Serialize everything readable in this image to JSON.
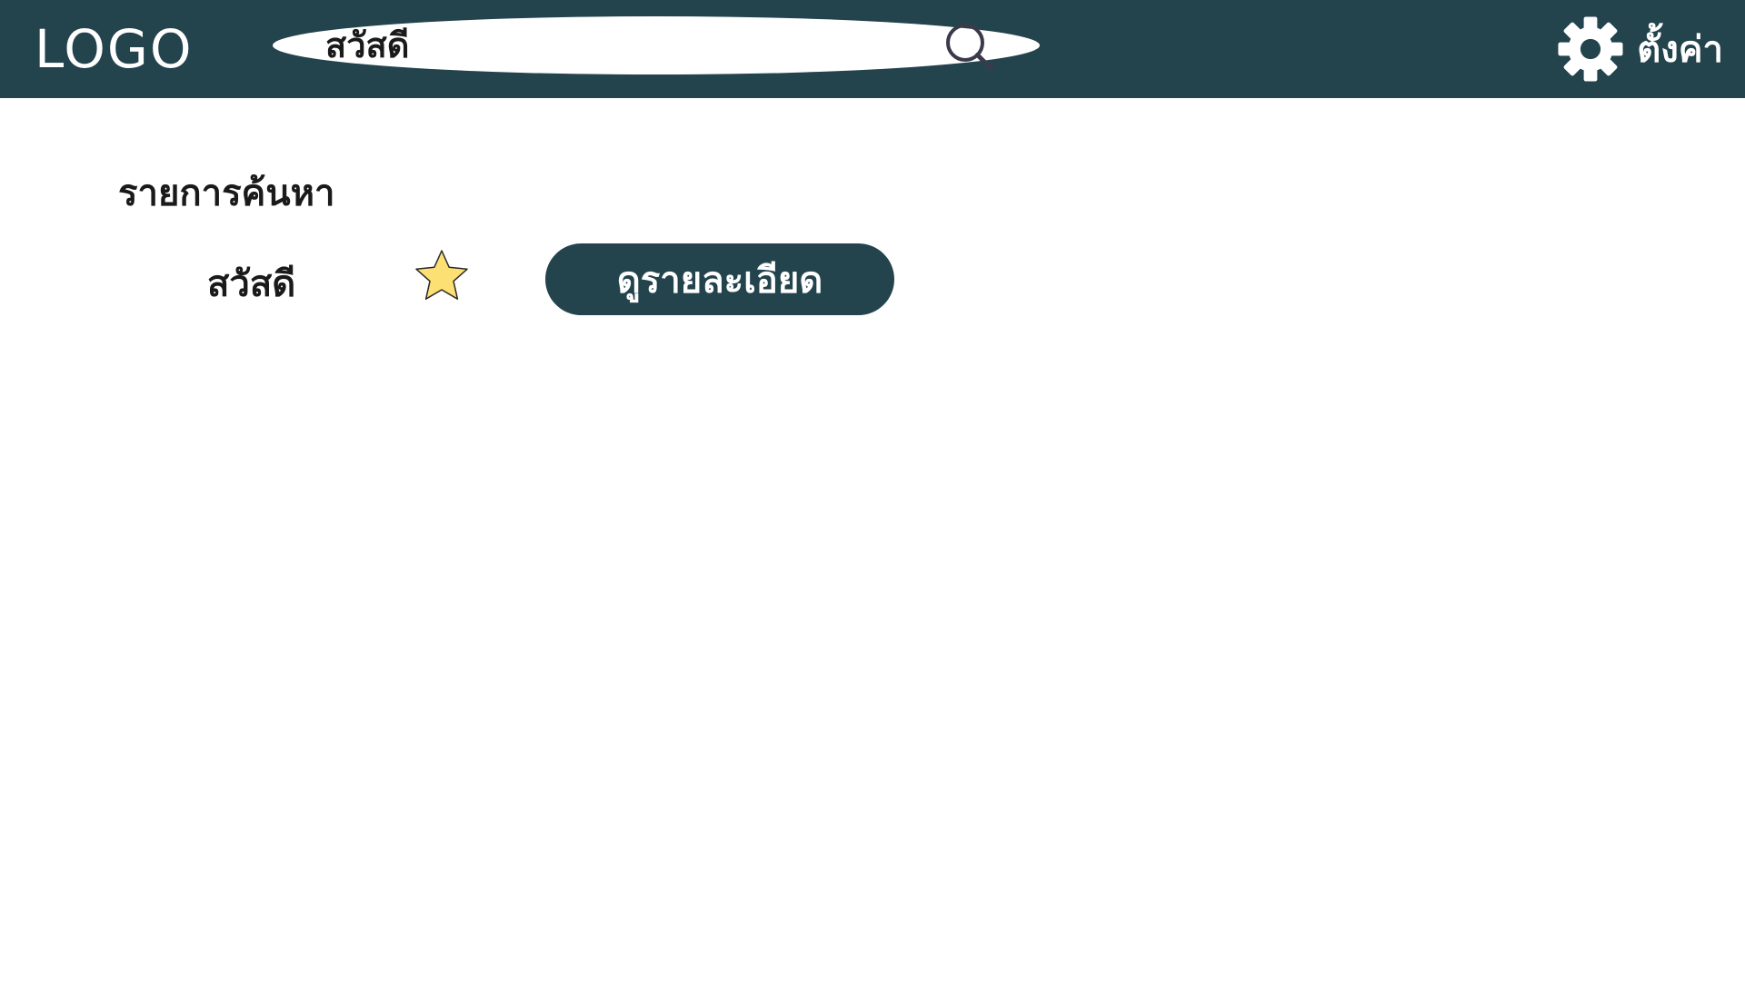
{
  "header": {
    "logo": "LOGO",
    "search": {
      "value": "สวัสดี"
    },
    "settings_label": "ตั้งค่า"
  },
  "main": {
    "section_title": "รายการค้นหา",
    "results": [
      {
        "title": "สวัสดี",
        "favorite": true,
        "button_label": "ดูรายละเอียด"
      }
    ]
  },
  "colors": {
    "header_bg": "#23434d",
    "accent": "#23434d",
    "star_fill": "#fde074"
  },
  "icons": [
    "search-icon",
    "gear-icon",
    "star-icon"
  ]
}
